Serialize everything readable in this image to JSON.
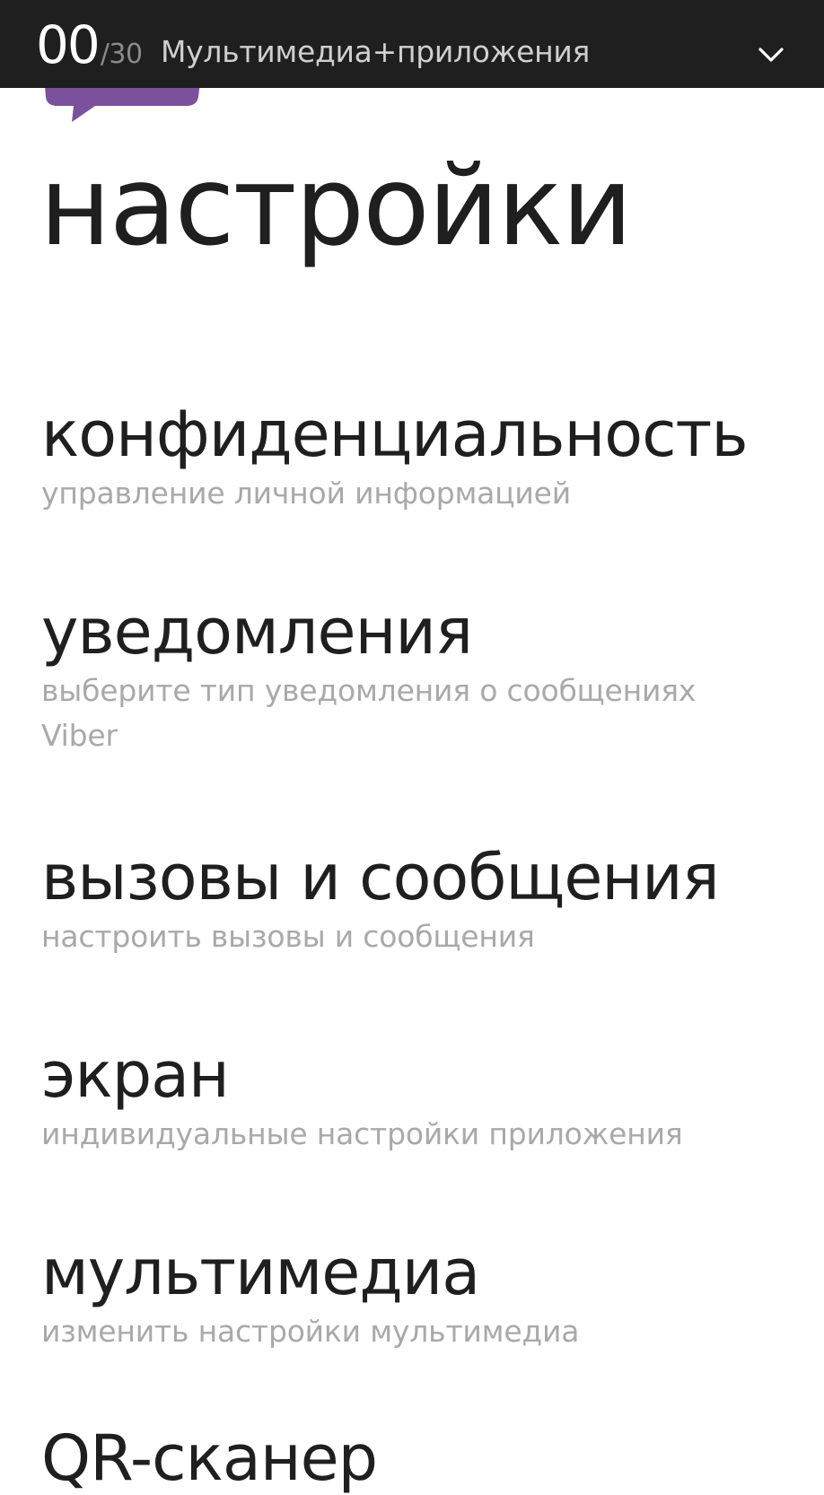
{
  "header": {
    "counter_current": "00",
    "counter_total": "/30",
    "title": "Мультимедиа+приложения",
    "chevron_icon": "chevron-down-icon"
  },
  "app": {
    "logo_icon": "viber-logo-icon",
    "brand_color": "#7b519d"
  },
  "page": {
    "title": "настройки"
  },
  "settings": {
    "items": [
      {
        "title": "конфиденциальность",
        "subtitle": "управление личной информацией"
      },
      {
        "title": "уведомления",
        "subtitle": "выберите тип уведомления о сообщениях Viber"
      },
      {
        "title": "вызовы и сообщения",
        "subtitle": "настроить вызовы и сообщения"
      },
      {
        "title": "экран",
        "subtitle": "индивидуальные настройки приложения"
      },
      {
        "title": "мультимедиа",
        "subtitle": "изменить настройки мультимедиа"
      },
      {
        "title": "QR-сканер",
        "subtitle": ""
      }
    ]
  }
}
